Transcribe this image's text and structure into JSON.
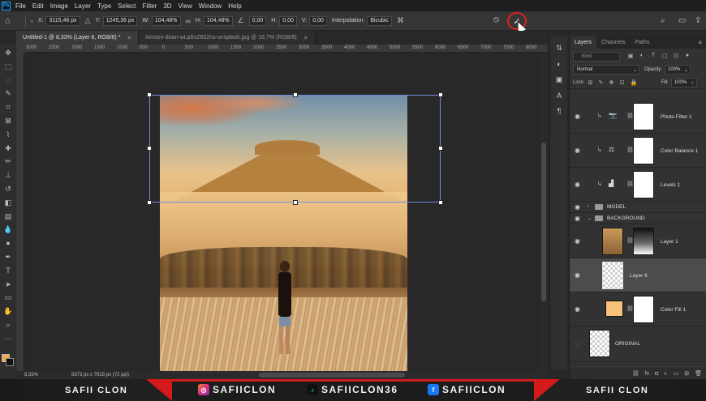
{
  "app": {
    "logo": "Ps",
    "menu": [
      "File",
      "Edit",
      "Image",
      "Layer",
      "Type",
      "Select",
      "Filter",
      "3D",
      "View",
      "Window",
      "Help"
    ]
  },
  "options": {
    "x_label": "X:",
    "x_value": "3115,46 px",
    "y_label": "Y:",
    "y_value": "1245,36 px",
    "w_label": "W:",
    "w_value": "104,48%",
    "h_label": "H:",
    "h_value": "104,48%",
    "angle_value": "0,00",
    "hskew_label": "H:",
    "hskew_value": "0,00",
    "vskew_label": "V:",
    "vskew_value": "0,00",
    "interp_label": "Interpolation:",
    "interp_value": "Bicubic"
  },
  "tabs": [
    {
      "label": "Untitled-1 @ 8,33% (Layer 6, RGB/8) *",
      "active": true
    },
    {
      "label": "kimson-doan-wLp6nZ602ns-unsplash.jpg @ 16,7% (RGB/8)",
      "active": false
    }
  ],
  "ruler_ticks": [
    "3000",
    "2500",
    "2000",
    "1500",
    "1000",
    "500",
    "0",
    "500",
    "1000",
    "1500",
    "2000",
    "2500",
    "3000",
    "3500",
    "4000",
    "4500",
    "5000",
    "5500",
    "6000",
    "6500",
    "7000",
    "7500",
    "8000",
    "8500"
  ],
  "status": {
    "zoom": "8,33%",
    "doc": "5673 px x 7618 px (72 ppi)"
  },
  "layers_panel": {
    "tabs": [
      "Layers",
      "Channels",
      "Paths"
    ],
    "kind_placeholder": "Kind",
    "blend_mode": "Normal",
    "opacity_label": "Opacity:",
    "opacity_value": "100%",
    "lock_label": "Lock:",
    "fill_label": "Fill:",
    "fill_value": "100%",
    "layers": [
      {
        "name": "Photo Filter 1"
      },
      {
        "name": "Color Balance 1"
      },
      {
        "name": "Levels 1"
      },
      {
        "name": "MODEL"
      },
      {
        "name": "BACKGROUND"
      },
      {
        "name": "Layer 1"
      },
      {
        "name": "Layer 6"
      },
      {
        "name": "Color Fill 1"
      },
      {
        "name": "ORIGINAL"
      }
    ],
    "colors": {
      "color_fill_swatch": "#f7c27a",
      "selected_row": "#4c4c4c"
    }
  },
  "banner": {
    "left_name": "SAFII CLON",
    "instagram": "SAFIICLON",
    "tiktok": "SAFIICLON36",
    "facebook": "SAFIICLON",
    "right_name": "SAFII CLON",
    "accent": "#d41a1a"
  },
  "colors": {
    "foreground_swatch": "#f4a84c",
    "background_swatch": "#111111",
    "commit_highlight": "#e02020",
    "transform_box": "#6e8fd6"
  }
}
